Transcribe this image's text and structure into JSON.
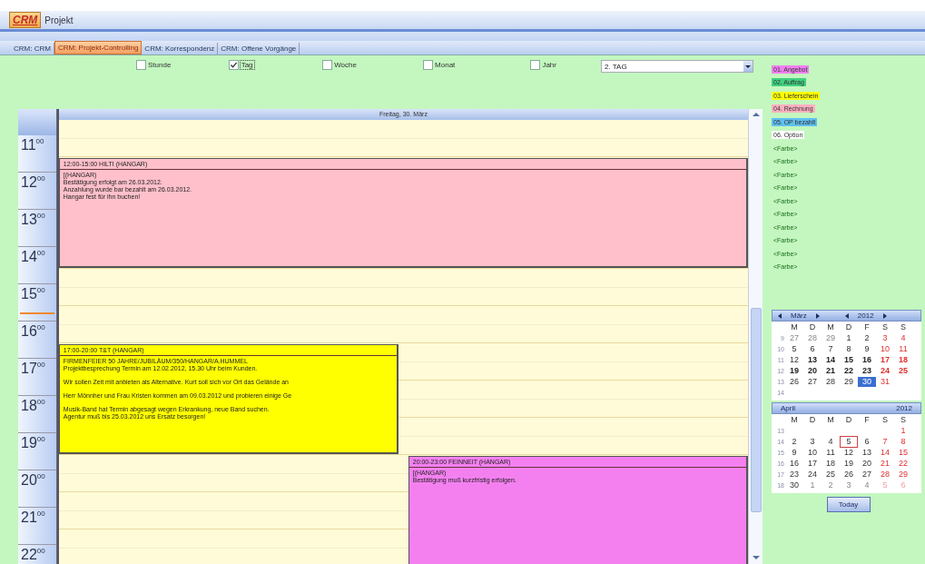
{
  "header": {
    "logo": "CRM",
    "title": "Projekt"
  },
  "tabs": [
    {
      "label": "CRM: CRM",
      "selected": false
    },
    {
      "label": "CRM: Projekt-Controlling",
      "selected": true
    },
    {
      "label": "CRM: Korrespondenz",
      "selected": false
    },
    {
      "label": "CRM: Offene Vorgänge",
      "selected": false
    }
  ],
  "view_options": [
    {
      "label": "Stunde",
      "checked": false
    },
    {
      "label": "Tag",
      "checked": true
    },
    {
      "label": "Woche",
      "checked": false
    },
    {
      "label": "Monat",
      "checked": false
    },
    {
      "label": "Jahr",
      "checked": false
    }
  ],
  "view_select": {
    "value": "2. TAG"
  },
  "day_view": {
    "date_heading": "Freitag, 30. März",
    "hours": [
      {
        "label": "11$^{00}$"
      },
      {
        "label": "12$^{00}$"
      },
      {
        "label": "13$^{00}$"
      },
      {
        "label": "14$^{00}$"
      },
      {
        "label": "15$^{00}$"
      },
      {
        "label": "16$^{00}$"
      },
      {
        "label": "17$^{00}$"
      },
      {
        "label": "18$^{00}$"
      },
      {
        "label": "19$^{00}$"
      },
      {
        "label": "20$^{00}$"
      },
      {
        "label": "21$^{00}$"
      },
      {
        "label": "22$^{00}$"
      }
    ],
    "appointments": [
      {
        "title": "12:00-15:00 HILTI (HANGAR)",
        "color": "#ffc0cb",
        "paragraphs": [
          [
            "[(HANGAR)",
            "Bestätigung erfolgt am 26.03.2012.",
            "Anzahlung wurde bar bezahlt am 26.03.2012.",
            "Hangar fest für ihn buchen!"
          ]
        ]
      },
      {
        "title": "17:00-20:00 T&T (HANGAR)",
        "color": "#ffff00",
        "paragraphs": [
          [
            "FIRMENFEIER 50 JAHRE/JUBILÄUM/350/HANGAR/A.HUMMEL",
            "Projektbesprechung Termin am 12.02.2012, 15.30 Uhr beim Kunden."
          ],
          [
            "Wir sollen Zeit mit anbieten als Alternative. Kurt soll sich vor Ort das Gelände an"
          ],
          [
            "Herr Mönnher und Frau Kristen kommen am 09.03.2012 und probieren einige Ge"
          ],
          [
            "Musik-Band hat Termin abgesagt wegen Erkrankung, neue Band suchen.",
            "Agentur muß bis 25.03.2012 uns Ersatz besorgen!"
          ]
        ]
      },
      {
        "title": "20:00-23:00 FEINNEIT (HANGAR)",
        "color": "#f480f0",
        "paragraphs": [
          [
            "[(HANGAR)",
            "Bestätigung muß kurzfristig erfolgen."
          ]
        ]
      }
    ]
  },
  "legend": [
    {
      "label": "01. Angebot",
      "color": "#f080f0"
    },
    {
      "label": "02. Auftrag",
      "color": "#40d080"
    },
    {
      "label": "03. Lieferschein",
      "color": "#ffff00"
    },
    {
      "label": "04. Rechnung",
      "color": "#ffb0c0"
    },
    {
      "label": "05. OP bezahlt",
      "color": "#60c0f0"
    },
    {
      "label": "06. Option",
      "color": "#ffffff"
    },
    {
      "label": "<Farbe>"
    },
    {
      "label": "<Farbe>"
    },
    {
      "label": "<Farbe>"
    },
    {
      "label": "<Farbe>"
    },
    {
      "label": "<Farbe>"
    },
    {
      "label": "<Farbe>"
    },
    {
      "label": "<Farbe>"
    },
    {
      "label": "<Farbe>"
    },
    {
      "label": "<Farbe>"
    },
    {
      "label": "<Farbe>"
    }
  ],
  "mini_calendars": [
    {
      "month": "März",
      "year": "2012",
      "navigation": true,
      "weekdays": [
        "M",
        "D",
        "M",
        "D",
        "F",
        "S",
        "S"
      ],
      "weeks": [
        {
          "week": "9",
          "days": [
            {
              "day": "27",
              "kind": "other",
              "weekend": false,
              "selected": false,
              "today": false
            },
            {
              "day": "28",
              "kind": "other",
              "weekend": false,
              "selected": false,
              "today": false
            },
            {
              "day": "29",
              "kind": "other",
              "weekend": false,
              "selected": false,
              "today": false
            },
            {
              "day": "1",
              "kind": "normal",
              "weekend": false,
              "selected": false,
              "today": false
            },
            {
              "day": "2",
              "kind": "normal",
              "weekend": false,
              "selected": false,
              "today": false
            },
            {
              "day": "3",
              "kind": "normal",
              "weekend": true,
              "selected": false,
              "today": false
            },
            {
              "day": "4",
              "kind": "normal",
              "weekend": true,
              "selected": false,
              "today": false
            }
          ]
        },
        {
          "week": "10",
          "days": [
            {
              "day": "5",
              "kind": "normal",
              "weekend": false,
              "selected": false,
              "today": false
            },
            {
              "day": "6",
              "kind": "normal",
              "weekend": false,
              "selected": false,
              "today": false
            },
            {
              "day": "7",
              "kind": "normal",
              "weekend": false,
              "selected": false,
              "today": false
            },
            {
              "day": "8",
              "kind": "normal",
              "weekend": false,
              "selected": false,
              "today": false
            },
            {
              "day": "9",
              "kind": "normal",
              "weekend": false,
              "selected": false,
              "today": false
            },
            {
              "day": "10",
              "kind": "normal",
              "weekend": true,
              "selected": false,
              "today": false
            },
            {
              "day": "11",
              "kind": "normal",
              "weekend": true,
              "selected": false,
              "today": false
            }
          ]
        },
        {
          "week": "11",
          "days": [
            {
              "day": "12",
              "kind": "normal",
              "weekend": false,
              "selected": false,
              "today": false
            },
            {
              "day": "13",
              "kind": "bold",
              "weekend": false,
              "selected": false,
              "today": false
            },
            {
              "day": "14",
              "kind": "bold",
              "weekend": false,
              "selected": false,
              "today": false
            },
            {
              "day": "15",
              "kind": "bold",
              "weekend": false,
              "selected": false,
              "today": false
            },
            {
              "day": "16",
              "kind": "bold",
              "weekend": false,
              "selected": false,
              "today": false
            },
            {
              "day": "17",
              "kind": "bold",
              "weekend": true,
              "selected": false,
              "today": false
            },
            {
              "day": "18",
              "kind": "bold",
              "weekend": true,
              "selected": false,
              "today": false
            }
          ]
        },
        {
          "week": "12",
          "days": [
            {
              "day": "19",
              "kind": "bold",
              "weekend": false,
              "selected": false,
              "today": false
            },
            {
              "day": "20",
              "kind": "bold",
              "weekend": false,
              "selected": false,
              "today": false
            },
            {
              "day": "21",
              "kind": "bold",
              "weekend": false,
              "selected": false,
              "today": false
            },
            {
              "day": "22",
              "kind": "bold",
              "weekend": false,
              "selected": false,
              "today": false
            },
            {
              "day": "23",
              "kind": "bold",
              "weekend": false,
              "selected": false,
              "today": false
            },
            {
              "day": "24",
              "kind": "bold",
              "weekend": true,
              "selected": false,
              "today": false
            },
            {
              "day": "25",
              "kind": "bold",
              "weekend": true,
              "selected": false,
              "today": false
            }
          ]
        },
        {
          "week": "13",
          "days": [
            {
              "day": "26",
              "kind": "normal",
              "weekend": false,
              "selected": false,
              "today": false
            },
            {
              "day": "27",
              "kind": "normal",
              "weekend": false,
              "selected": false,
              "today": false
            },
            {
              "day": "28",
              "kind": "normal",
              "weekend": false,
              "selected": false,
              "today": false
            },
            {
              "day": "29",
              "kind": "normal",
              "weekend": false,
              "selected": false,
              "today": false
            },
            {
              "day": "30",
              "kind": "normal",
              "weekend": false,
              "selected": true,
              "today": false
            },
            {
              "day": "31",
              "kind": "normal",
              "weekend": true,
              "selected": false,
              "today": false
            },
            {
              "kind": "blank"
            }
          ]
        },
        {
          "week": "14"
        }
      ]
    },
    {
      "month": "April",
      "year": "2012",
      "navigation": false,
      "weekdays": [
        "M",
        "D",
        "M",
        "D",
        "F",
        "S",
        "S"
      ],
      "weeks": [
        {
          "week": "13",
          "days": [
            {
              "kind": "blank"
            },
            {
              "kind": "blank"
            },
            {
              "kind": "blank"
            },
            {
              "kind": "blank"
            },
            {
              "kind": "blank"
            },
            {
              "kind": "blank"
            },
            {
              "day": "1",
              "kind": "normal",
              "weekend": true,
              "selected": false,
              "today": false
            }
          ]
        },
        {
          "week": "14",
          "days": [
            {
              "day": "2",
              "kind": "normal",
              "weekend": false,
              "selected": false,
              "today": false
            },
            {
              "day": "3",
              "kind": "normal",
              "weekend": false,
              "selected": false,
              "today": false
            },
            {
              "day": "4",
              "kind": "normal",
              "weekend": false,
              "selected": false,
              "today": false
            },
            {
              "day": "5",
              "kind": "normal",
              "weekend": false,
              "selected": false,
              "today": true
            },
            {
              "day": "6",
              "kind": "normal",
              "weekend": false,
              "selected": false,
              "today": false
            },
            {
              "day": "7",
              "kind": "normal",
              "weekend": true,
              "selected": false,
              "today": false
            },
            {
              "day": "8",
              "kind": "normal",
              "weekend": true,
              "selected": false,
              "today": false
            }
          ]
        },
        {
          "week": "15",
          "days": [
            {
              "day": "9",
              "kind": "normal",
              "weekend": false,
              "selected": false,
              "today": false
            },
            {
              "day": "10",
              "kind": "normal",
              "weekend": false,
              "selected": false,
              "today": false
            },
            {
              "day": "11",
              "kind": "normal",
              "weekend": false,
              "selected": false,
              "today": false
            },
            {
              "day": "12",
              "kind": "normal",
              "weekend": false,
              "selected": false,
              "today": false
            },
            {
              "day": "13",
              "kind": "normal",
              "weekend": false,
              "selected": false,
              "today": false
            },
            {
              "day": "14",
              "kind": "normal",
              "weekend": true,
              "selected": false,
              "today": false
            },
            {
              "day": "15",
              "kind": "normal",
              "weekend": true,
              "selected": false,
              "today": false
            }
          ]
        },
        {
          "week": "16",
          "days": [
            {
              "day": "16",
              "kind": "normal",
              "weekend": false,
              "selected": false,
              "today": false
            },
            {
              "day": "17",
              "kind": "normal",
              "weekend": false,
              "selected": false,
              "today": false
            },
            {
              "day": "18",
              "kind": "normal",
              "weekend": false,
              "selected": false,
              "today": false
            },
            {
              "day": "19",
              "kind": "normal",
              "weekend": false,
              "selected": false,
              "today": false
            },
            {
              "day": "20",
              "kind": "normal",
              "weekend": false,
              "selected": false,
              "today": false
            },
            {
              "day": "21",
              "kind": "normal",
              "weekend": true,
              "selected": false,
              "today": false
            },
            {
              "day": "22",
              "kind": "normal",
              "weekend": true,
              "selected": false,
              "today": false
            }
          ]
        },
        {
          "week": "17",
          "days": [
            {
              "day": "23",
              "kind": "normal",
              "weekend": false,
              "selected": false,
              "today": false
            },
            {
              "day": "24",
              "kind": "normal",
              "weekend": false,
              "selected": false,
              "today": false
            },
            {
              "day": "25",
              "kind": "normal",
              "weekend": false,
              "selected": false,
              "today": false
            },
            {
              "day": "26",
              "kind": "normal",
              "weekend": false,
              "selected": false,
              "today": false
            },
            {
              "day": "27",
              "kind": "normal",
              "weekend": false,
              "selected": false,
              "today": false
            },
            {
              "day": "28",
              "kind": "normal",
              "weekend": true,
              "selected": false,
              "today": false
            },
            {
              "day": "29",
              "kind": "normal",
              "weekend": true,
              "selected": false,
              "today": false
            }
          ]
        },
        {
          "week": "18",
          "days": [
            {
              "day": "30",
              "kind": "normal",
              "weekend": false,
              "selected": false,
              "today": false
            },
            {
              "day": "1",
              "kind": "other",
              "weekend": false,
              "selected": false,
              "today": false
            },
            {
              "day": "2",
              "kind": "other",
              "weekend": false,
              "selected": false,
              "today": false
            },
            {
              "day": "3",
              "kind": "other",
              "weekend": false,
              "selected": false,
              "today": false
            },
            {
              "day": "4",
              "kind": "other",
              "weekend": false,
              "selected": false,
              "today": false
            },
            {
              "day": "5",
              "kind": "other",
              "weekend": true,
              "selected": false,
              "today": false
            },
            {
              "day": "6",
              "kind": "other",
              "weekend": true,
              "selected": false,
              "today": false
            }
          ]
        }
      ]
    }
  ],
  "today_button": {
    "label": "Today"
  }
}
